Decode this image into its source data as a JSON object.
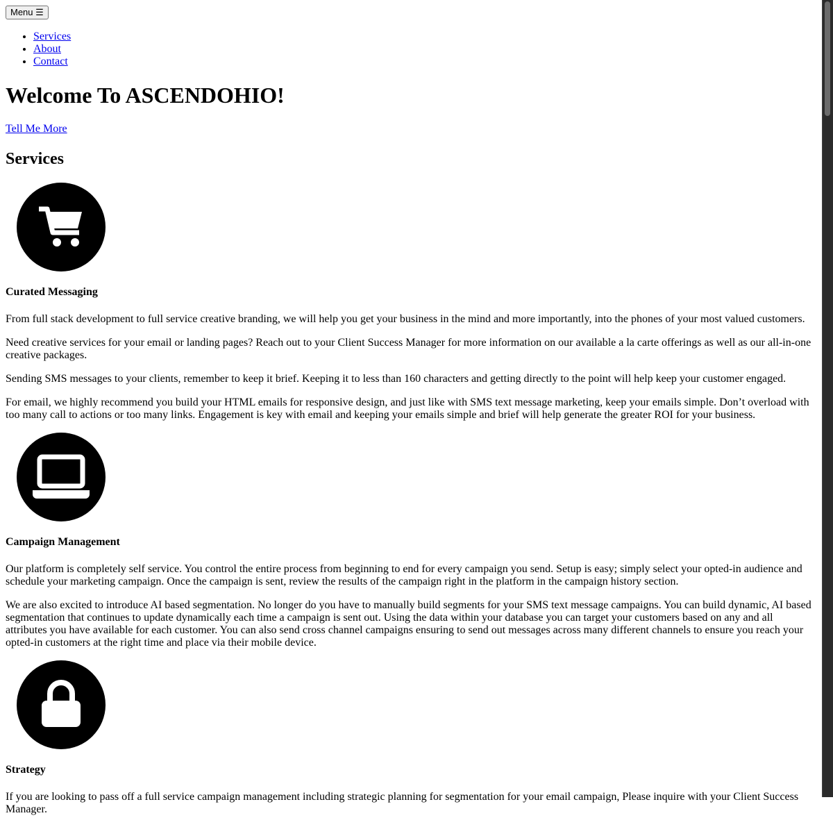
{
  "nav": {
    "menu_button": "Menu ☰",
    "items": [
      {
        "label": "Services"
      },
      {
        "label": "About"
      },
      {
        "label": "Contact"
      }
    ]
  },
  "hero": {
    "title": "Welcome To ASCENDOHIO!",
    "cta": "Tell Me More"
  },
  "services": {
    "heading": "Services",
    "items": [
      {
        "icon": "shopping-cart-icon",
        "title": "Curated Messaging",
        "paragraphs": [
          "From full stack development to full service creative branding, we will help you get your business in the mind and more importantly, into the phones of your most valued customers.",
          "Need creative services for your email or landing pages? Reach out to your Client Success Manager for more information on our available a la carte offerings as well as our all-in-one creative packages.",
          "Sending SMS messages to your clients, remember to keep it brief. Keeping it to less than 160 characters and getting directly to the point will help keep your customer engaged.",
          "For email, we highly recommend you build your HTML emails for responsive design, and just like with SMS text message marketing, keep your emails simple. Don’t overload with too many call to actions or too many links. Engagement is key with email and keeping your emails simple and brief will help generate the greater ROI for your business."
        ]
      },
      {
        "icon": "laptop-icon",
        "title": "Campaign Management",
        "paragraphs": [
          "Our platform is completely self service. You control the entire process from beginning to end for every campaign you send. Setup is easy; simply select your opted-in audience and schedule your marketing campaign. Once the campaign is sent, review the results of the campaign right in the platform in the campaign history section.",
          "We are also excited to introduce AI based segmentation. No longer do you have to manually build segments for your SMS text message campaigns. You can build dynamic, AI based segmentation that continues to update dynamically each time a campaign is sent out. Using the data within your database you can target your customers based on any and all attributes you have available for each customer. You can also send cross channel campaigns ensuring to send out messages across many different channels to ensure you reach your opted-in customers at the right time and place via their mobile device."
        ]
      },
      {
        "icon": "lock-icon",
        "title": "Strategy",
        "paragraphs": [
          "If you are looking to pass off a full service campaign management including strategic planning for segmentation for your email campaign, Please inquire with your Client Success Manager."
        ]
      }
    ]
  }
}
